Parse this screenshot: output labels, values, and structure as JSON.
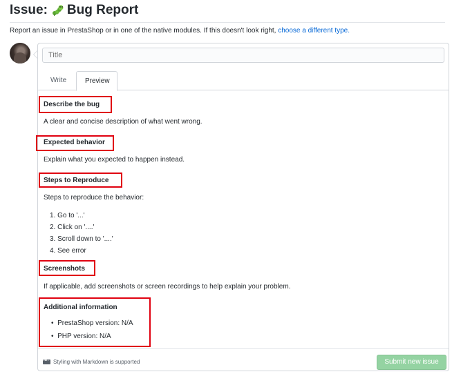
{
  "header": {
    "title_prefix": "Issue:",
    "title_text": "Bug Report",
    "subtitle_text": "Report an issue in PrestaShop or in one of the native modules. If this doesn't look right, ",
    "subtitle_link": "choose a different type."
  },
  "form": {
    "title_placeholder": "Title",
    "tabs": [
      {
        "label": "Write",
        "active": false
      },
      {
        "label": "Preview",
        "active": true
      }
    ]
  },
  "preview": {
    "sections": [
      {
        "heading": "Describe the bug",
        "body": "A clear and concise description of what went wrong."
      },
      {
        "heading": "Expected behavior",
        "body": "Explain what you expected to happen instead."
      },
      {
        "heading": "Steps to Reproduce",
        "body": "Steps to reproduce the behavior:"
      },
      {
        "heading": "Screenshots",
        "body": "If applicable, add screenshots or screen recordings to help explain your problem."
      },
      {
        "heading": "Additional information",
        "body": ""
      }
    ],
    "steps": [
      "Go to '...'",
      "Click on '....'",
      "Scroll down to '....'",
      "See error"
    ],
    "info_items": [
      "PrestaShop version: N/A",
      "PHP version: N/A"
    ]
  },
  "footer": {
    "markdown_note": "Styling with Markdown is supported",
    "submit_label": "Submit new issue"
  },
  "colors": {
    "link": "#0366d6",
    "highlight_border": "#e0000f",
    "submit_disabled": "#94d3a2"
  },
  "icons": {
    "title_emoji": "caterpillar-icon",
    "markdown": "markdown-icon"
  }
}
